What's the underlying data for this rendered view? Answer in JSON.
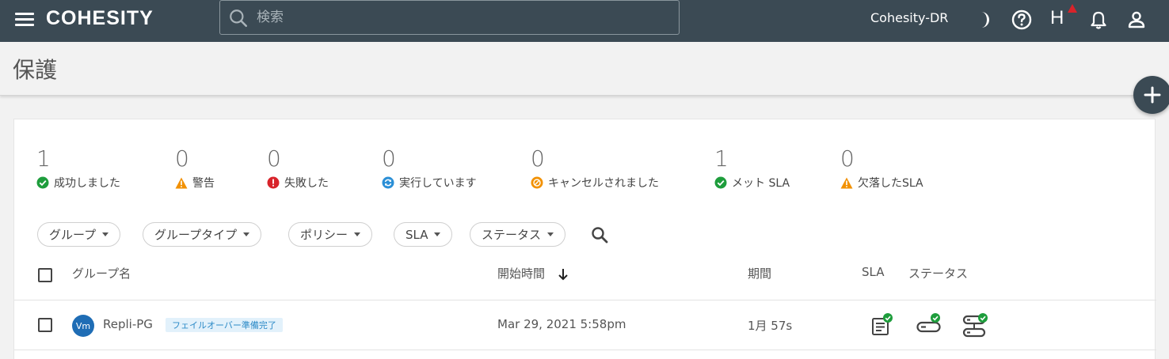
{
  "app": {
    "logo": "COHESITY",
    "search_placeholder": "検索",
    "cluster_name": "Cohesity-DR",
    "helios_label": "H"
  },
  "page": {
    "title": "保護"
  },
  "stats": [
    {
      "value": "1",
      "label": "成功しました",
      "status": "success",
      "color": "#1e9d3c"
    },
    {
      "value": "0",
      "label": "警告",
      "status": "warning",
      "color": "#f29100"
    },
    {
      "value": "0",
      "label": "失敗した",
      "status": "error",
      "color": "#d8232a"
    },
    {
      "value": "0",
      "label": "実行しています",
      "status": "running",
      "color": "#2b8fd6"
    },
    {
      "value": "0",
      "label": "キャンセルされました",
      "status": "cancelled",
      "color": "#f29100"
    },
    {
      "value": "1",
      "label": "メット SLA",
      "status": "success",
      "color": "#1e9d3c"
    },
    {
      "value": "0",
      "label": "欠落したSLA",
      "status": "warning",
      "color": "#f29100"
    }
  ],
  "filters": [
    {
      "label": "グループ"
    },
    {
      "label": "グループタイプ"
    },
    {
      "label": "ポリシー"
    },
    {
      "label": "SLA"
    },
    {
      "label": "ステータス"
    }
  ],
  "table": {
    "columns": {
      "name": "グループ名",
      "start_time": "開始時間",
      "duration": "期間",
      "sla": "SLA",
      "status": "ステータス"
    },
    "sort": {
      "column": "start_time",
      "direction": "desc"
    },
    "rows": [
      {
        "avatar": "Vm",
        "name": "Repli-PG",
        "badge": "フェイルオーバー準備完了",
        "start_time": "Mar 29, 2021 5:58pm",
        "duration": "1月 57s"
      }
    ]
  },
  "colors": {
    "topbar": "#3b4a54",
    "success": "#1e9d3c",
    "avatar": "#1f6db5",
    "badge_bg": "#e2f1fb",
    "badge_text": "#2c8ac7",
    "alert": "#d8232a"
  }
}
